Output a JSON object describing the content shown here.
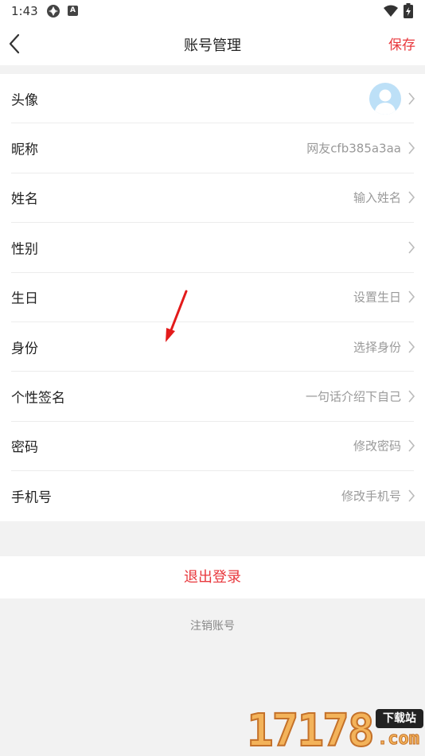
{
  "status_bar": {
    "time": "1:43",
    "icon_b_letter": "A"
  },
  "nav": {
    "title": "账号管理",
    "save_label": "保存"
  },
  "rows": [
    {
      "label": "头像",
      "value": ""
    },
    {
      "label": "昵称",
      "value": "网友cfb385a3aa"
    },
    {
      "label": "姓名",
      "value": "输入姓名"
    },
    {
      "label": "性别",
      "value": ""
    },
    {
      "label": "生日",
      "value": "设置生日"
    },
    {
      "label": "身份",
      "value": "选择身份"
    },
    {
      "label": "个性签名",
      "value": "一句话介绍下自己"
    },
    {
      "label": "密码",
      "value": "修改密码"
    },
    {
      "label": "手机号",
      "value": "修改手机号"
    }
  ],
  "logout_label": "退出登录",
  "cancel_account_label": "注销账号",
  "watermark": {
    "digits": "17178",
    "badge": "下载站",
    "domain": ".com"
  },
  "colors": {
    "accent": "#e8383d",
    "background": "#f2f2f2",
    "avatar_bg": "#bde0f7"
  }
}
